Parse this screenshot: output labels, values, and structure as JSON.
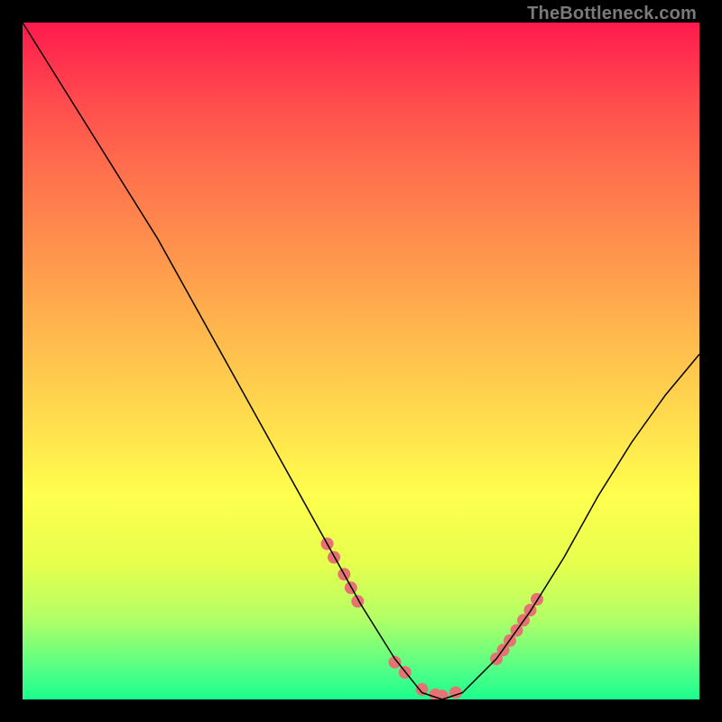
{
  "watermark": "TheBottleneck.com",
  "chart_data": {
    "type": "line",
    "title": "",
    "xlabel": "",
    "ylabel": "",
    "xlim": [
      0,
      100
    ],
    "ylim": [
      0,
      100
    ],
    "background_gradient": {
      "top": "#ff1a4d",
      "mid": "#ffff4d",
      "bottom": "#1aff8c"
    },
    "series": [
      {
        "name": "bottleneck-curve",
        "x": [
          0,
          5,
          10,
          15,
          20,
          25,
          30,
          35,
          40,
          45,
          50,
          55,
          59,
          62,
          65,
          70,
          75,
          80,
          85,
          90,
          95,
          100
        ],
        "y": [
          100,
          92,
          84,
          76,
          68,
          59,
          50,
          41,
          32,
          23,
          14,
          6,
          1,
          0,
          1,
          6,
          13,
          21,
          30,
          38,
          45,
          51
        ],
        "color": "#000000",
        "width": 1.5
      }
    ],
    "dot_overlay": {
      "name": "highlight-dots",
      "color": "#e57373",
      "radius": 7,
      "points_xy": [
        [
          45,
          23
        ],
        [
          46,
          21
        ],
        [
          47.5,
          18.5
        ],
        [
          48.5,
          16.5
        ],
        [
          49.5,
          14.5
        ],
        [
          55,
          5.5
        ],
        [
          56.5,
          4
        ],
        [
          59,
          1.5
        ],
        [
          61,
          0.7
        ],
        [
          62,
          0.5
        ],
        [
          64,
          1
        ],
        [
          70,
          6
        ],
        [
          71,
          7.3
        ],
        [
          72,
          8.7
        ],
        [
          73,
          10.2
        ],
        [
          74,
          11.7
        ],
        [
          75,
          13.2
        ],
        [
          76,
          14.8
        ]
      ]
    }
  }
}
